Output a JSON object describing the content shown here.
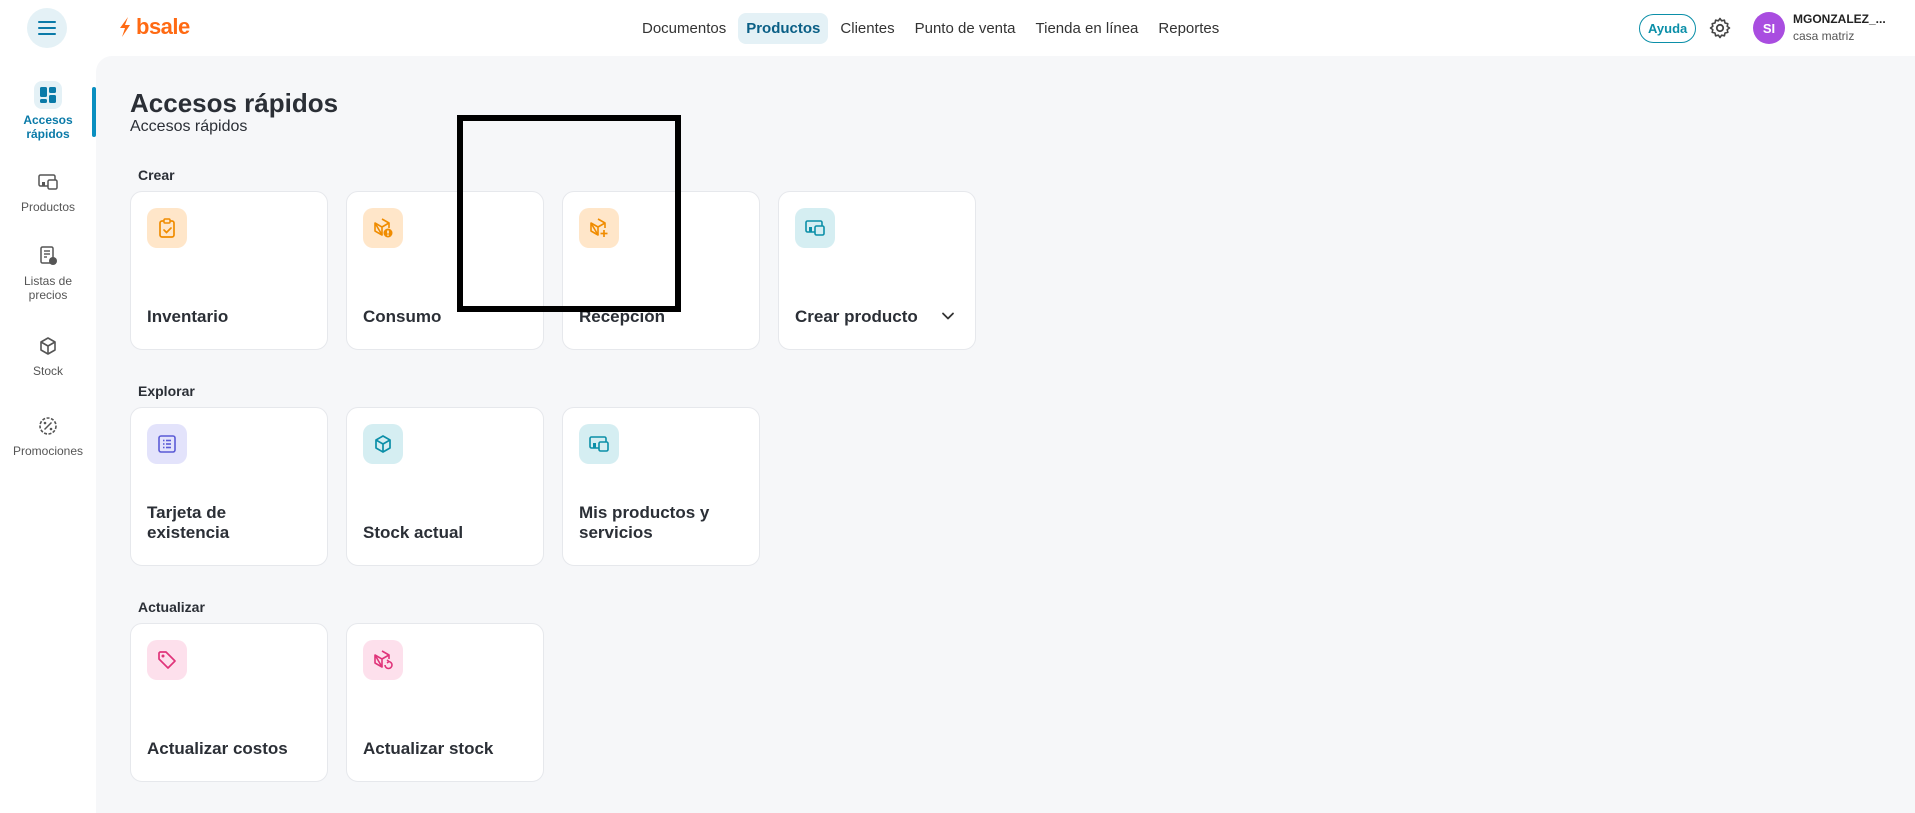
{
  "header": {
    "logo_text": "bsale",
    "nav": [
      "Documentos",
      "Productos",
      "Clientes",
      "Punto de venta",
      "Tienda en línea",
      "Reportes"
    ],
    "active_nav": "Productos",
    "help_label": "Ayuda",
    "avatar_initials": "SI",
    "user_name": "MGONZALEZ_...",
    "user_branch": "casa matriz"
  },
  "sidebar": {
    "items": [
      {
        "label": "Accesos rápidos",
        "icon": "dashboard-icon",
        "active": true
      },
      {
        "label": "Productos",
        "icon": "products-icon"
      },
      {
        "label": "Listas de precios",
        "icon": "price-list-icon"
      },
      {
        "label": "Stock",
        "icon": "cube-icon"
      },
      {
        "label": "Promociones",
        "icon": "discount-icon"
      }
    ]
  },
  "main": {
    "title": "Accesos rápidos",
    "subtitle": "Accesos rápidos",
    "sections": {
      "crear": {
        "label": "Crear",
        "cards": [
          "Inventario",
          "Consumo",
          "Recepción",
          "Crear producto"
        ]
      },
      "explorar": {
        "label": "Explorar",
        "cards": [
          "Tarjeta de existencia",
          "Stock actual",
          "Mis productos y servicios"
        ]
      },
      "actualizar": {
        "label": "Actualizar",
        "cards": [
          "Actualizar costos",
          "Actualizar stock"
        ]
      }
    }
  },
  "colors": {
    "brand": "#ff6a13",
    "accent": "#0a8fc0",
    "orange_tile": "#ffe6c9",
    "teal_tile": "#d5eef2",
    "violet_tile": "#e3e3fb",
    "pink_tile": "#fde0ec"
  }
}
